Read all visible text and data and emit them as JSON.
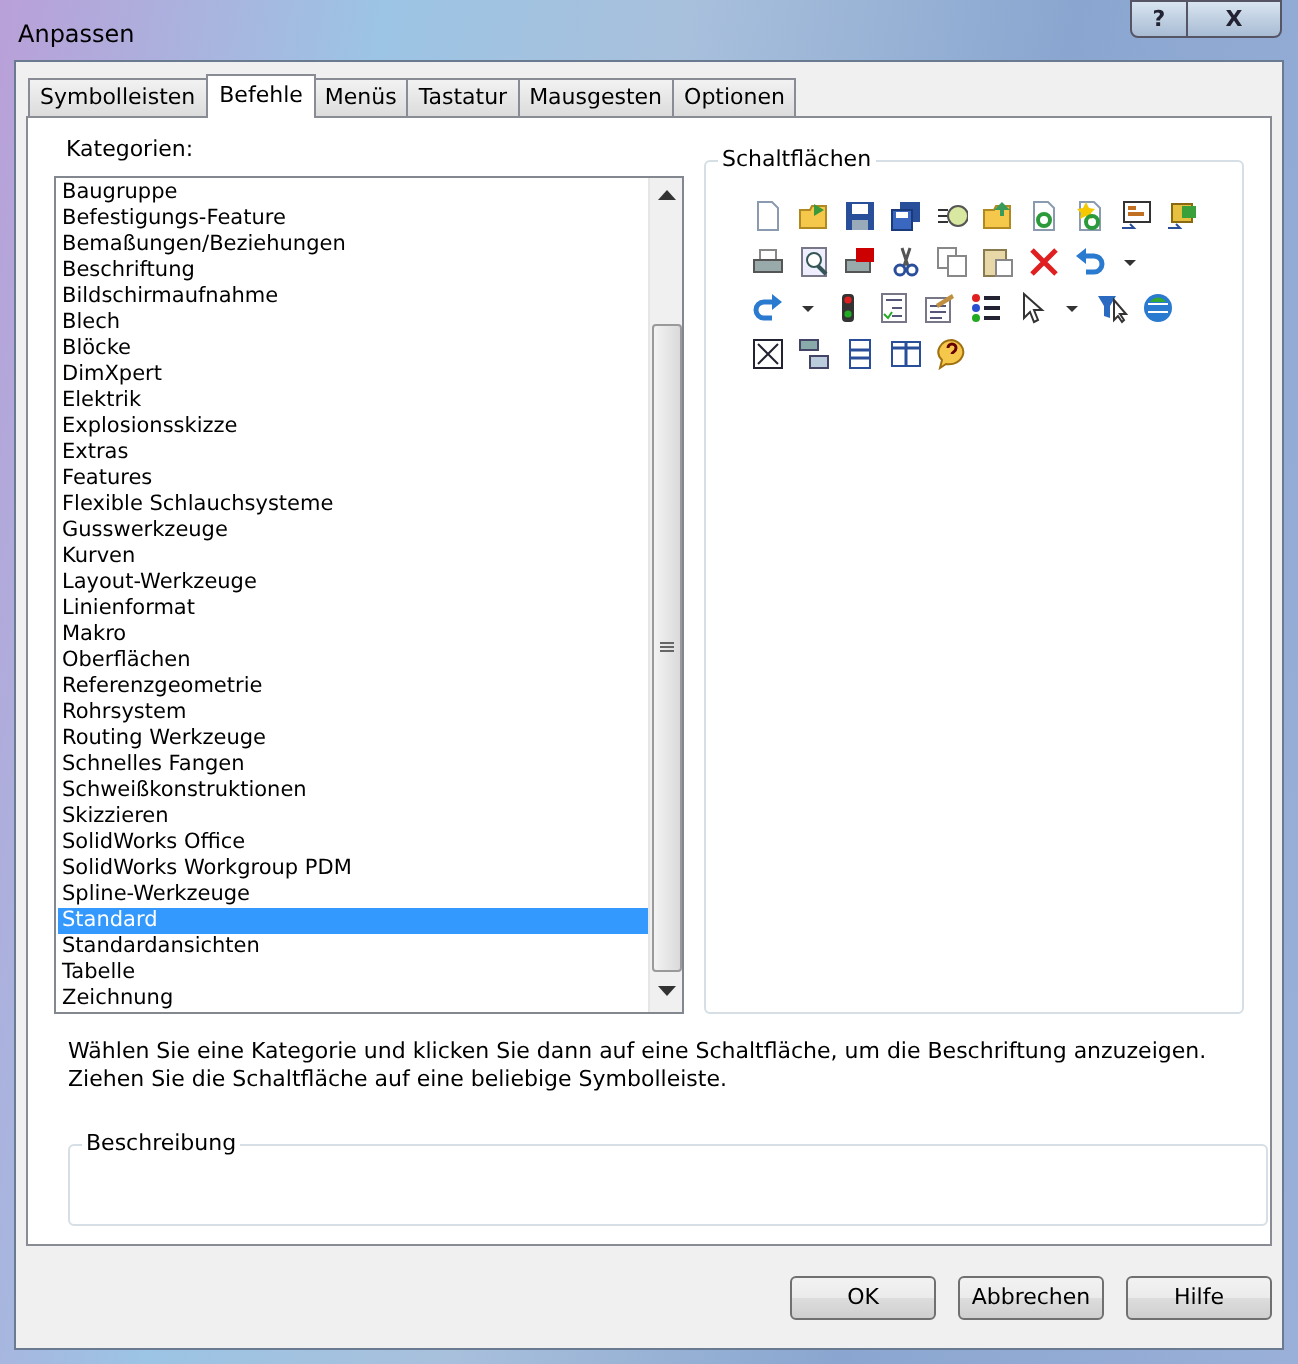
{
  "window": {
    "title": "Anpassen",
    "help_button": "?",
    "close_button": "X"
  },
  "tabs": [
    {
      "label": "Symbolleisten",
      "selected": false
    },
    {
      "label": "Befehle",
      "selected": true
    },
    {
      "label": "Menüs",
      "selected": false
    },
    {
      "label": "Tastatur",
      "selected": false
    },
    {
      "label": "Mausgesten",
      "selected": false
    },
    {
      "label": "Optionen",
      "selected": false
    }
  ],
  "categories": {
    "label": "Kategorien:",
    "items": [
      {
        "label": "Baugruppe",
        "selected": false
      },
      {
        "label": "Befestigungs-Feature",
        "selected": false
      },
      {
        "label": "Bemaßungen/Beziehungen",
        "selected": false
      },
      {
        "label": "Beschriftung",
        "selected": false
      },
      {
        "label": "Bildschirmaufnahme",
        "selected": false
      },
      {
        "label": "Blech",
        "selected": false
      },
      {
        "label": "Blöcke",
        "selected": false
      },
      {
        "label": "DimXpert",
        "selected": false
      },
      {
        "label": "Elektrik",
        "selected": false
      },
      {
        "label": "Explosionsskizze",
        "selected": false
      },
      {
        "label": "Extras",
        "selected": false
      },
      {
        "label": "Features",
        "selected": false
      },
      {
        "label": "Flexible Schlauchsysteme",
        "selected": false
      },
      {
        "label": "Gusswerkzeuge",
        "selected": false
      },
      {
        "label": "Kurven",
        "selected": false
      },
      {
        "label": "Layout-Werkzeuge",
        "selected": false
      },
      {
        "label": "Linienformat",
        "selected": false
      },
      {
        "label": "Makro",
        "selected": false
      },
      {
        "label": "Oberflächen",
        "selected": false
      },
      {
        "label": "Referenzgeometrie",
        "selected": false
      },
      {
        "label": "Rohrsystem",
        "selected": false
      },
      {
        "label": "Routing Werkzeuge",
        "selected": false
      },
      {
        "label": "Schnelles Fangen",
        "selected": false
      },
      {
        "label": "Schweißkonstruktionen",
        "selected": false
      },
      {
        "label": "Skizzieren",
        "selected": false
      },
      {
        "label": "SolidWorks Office",
        "selected": false
      },
      {
        "label": "SolidWorks Workgroup PDM",
        "selected": false
      },
      {
        "label": "Spline-Werkzeuge",
        "selected": false
      },
      {
        "label": "Standard",
        "selected": true
      },
      {
        "label": "Standardansichten",
        "selected": false
      },
      {
        "label": "Tabelle",
        "selected": false
      },
      {
        "label": "Zeichnung",
        "selected": false
      }
    ]
  },
  "buttons_group": {
    "title": "Schaltflächen"
  },
  "hint": [
    "Wählen Sie eine Kategorie und klicken Sie dann auf eine Schaltfläche, um die Beschriftung anzuzeigen.",
    "Ziehen Sie die Schaltfläche auf eine beliebige Symbolleiste."
  ],
  "description": {
    "title": "Beschreibung"
  },
  "buttons": [
    "OK",
    "Abbrechen",
    "Hilfe"
  ]
}
